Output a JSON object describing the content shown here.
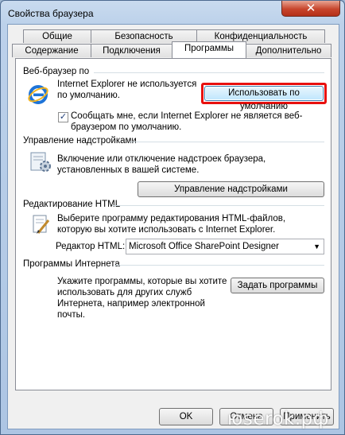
{
  "window": {
    "title": "Свойства браузера",
    "close_glyph": "✕"
  },
  "tabs": {
    "row1": [
      "Общие",
      "Безопасность",
      "Конфиденциальность"
    ],
    "row2": [
      "Содержание",
      "Подключения",
      "Программы",
      "Дополнительно"
    ],
    "active": "Программы"
  },
  "web_browser": {
    "label": "Веб-браузер по",
    "status": "Internet Explorer не используется по умолчанию.",
    "default_button": "Использовать по умолчанию",
    "notify_checked": true,
    "notify_text": "Сообщать мне, если Internet Explorer не является веб-браузером по умолчанию."
  },
  "addons": {
    "label": "Управление надстройками",
    "description": "Включение или отключение надстроек браузера, установленных в вашей системе.",
    "button": "Управление надстройками"
  },
  "html_editing": {
    "label": "Редактирование HTML",
    "description": "Выберите программу редактирования HTML-файлов, которую вы хотите использовать с Internet Explorer.",
    "editor_label": "Редактор HTML:",
    "editor_value": "Microsoft Office SharePoint Designer"
  },
  "internet_programs": {
    "label": "Программы Интернета",
    "description": "Укажите программы, которые вы хотите использовать для других служб Интернета, например электронной почты.",
    "button": "Задать программы"
  },
  "footer": {
    "ok": "OK",
    "cancel": "Отмена",
    "apply": "Применить"
  },
  "watermark": "юserok.рф"
}
